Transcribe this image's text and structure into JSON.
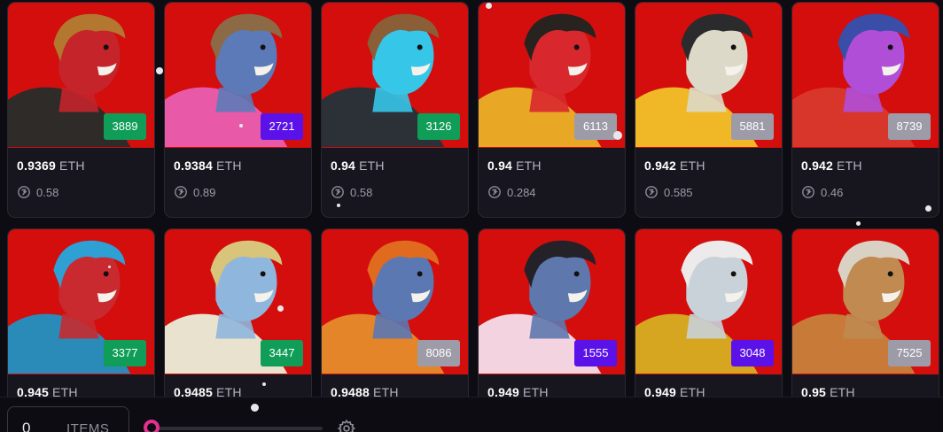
{
  "colors": {
    "common": "#9e9ba8",
    "uncommon": "#0f9d58",
    "rare": "#5b12e8",
    "art_background": "#d40d0d"
  },
  "price_unit": "ETH",
  "reward_icon": "reward-icon",
  "cards": [
    {
      "rank": "3889",
      "rank_color": "#0f9d58",
      "price": "0.9369",
      "unit": "ETH",
      "reward": "0.58",
      "skin": "#c4242a",
      "hair": "#b3772f",
      "outfit": "#2f2b28"
    },
    {
      "rank": "2721",
      "rank_color": "#5b12e8",
      "price": "0.9384",
      "unit": "ETH",
      "reward": "0.89",
      "skin": "#5d7ab8",
      "hair": "#8b6a45",
      "outfit": "#e85aa8"
    },
    {
      "rank": "3126",
      "rank_color": "#0f9d58",
      "price": "0.94",
      "unit": "ETH",
      "reward": "0.58",
      "skin": "#35c6e8",
      "hair": "#8a5f38",
      "outfit": "#2c3138"
    },
    {
      "rank": "6113",
      "rank_color": "#9e9ba8",
      "price": "0.94",
      "unit": "ETH",
      "reward": "0.284",
      "skin": "#d8282e",
      "hair": "#28231f",
      "outfit": "#e8a724"
    },
    {
      "rank": "5881",
      "rank_color": "#9e9ba8",
      "price": "0.942",
      "unit": "ETH",
      "reward": "0.585",
      "skin": "#dcd9c8",
      "hair": "#2b2a2c",
      "outfit": "#f0b827"
    },
    {
      "rank": "8739",
      "rank_color": "#9e9ba8",
      "price": "0.942",
      "unit": "ETH",
      "reward": "0.46",
      "skin": "#b14ed8",
      "hair": "#3a4ea8",
      "outfit": "#d8352b"
    },
    {
      "rank": "3377",
      "rank_color": "#0f9d58",
      "price": "0.945",
      "unit": "ETH",
      "reward": "",
      "skin": "#c82a30",
      "hair": "#2ea0d4",
      "outfit": "#2a8ab8"
    },
    {
      "rank": "3447",
      "rank_color": "#0f9d58",
      "price": "0.9485",
      "unit": "ETH",
      "reward": "",
      "skin": "#8fb6dc",
      "hair": "#d8c47a",
      "outfit": "#e8e2cf"
    },
    {
      "rank": "8086",
      "rank_color": "#9e9ba8",
      "price": "0.9488",
      "unit": "ETH",
      "reward": "",
      "skin": "#5b78b3",
      "hair": "#e06b1f",
      "outfit": "#e4852a"
    },
    {
      "rank": "1555",
      "rank_color": "#5b12e8",
      "price": "0.949",
      "unit": "ETH",
      "reward": "",
      "skin": "#5e78ad",
      "hair": "#242228",
      "outfit": "#f4d3e0"
    },
    {
      "rank": "3048",
      "rank_color": "#5b12e8",
      "price": "0.949",
      "unit": "ETH",
      "reward": "",
      "skin": "#c9d2d8",
      "hair": "#eceaea",
      "outfit": "#d6a620"
    },
    {
      "rank": "7525",
      "rank_color": "#9e9ba8",
      "price": "0.95",
      "unit": "ETH",
      "reward": "",
      "skin": "#c08a50",
      "hair": "#d9d2c4",
      "outfit": "#c87a38"
    }
  ],
  "footer": {
    "items_count": "0",
    "items_label": "ITEMS",
    "settings_icon": "gear-icon"
  }
}
